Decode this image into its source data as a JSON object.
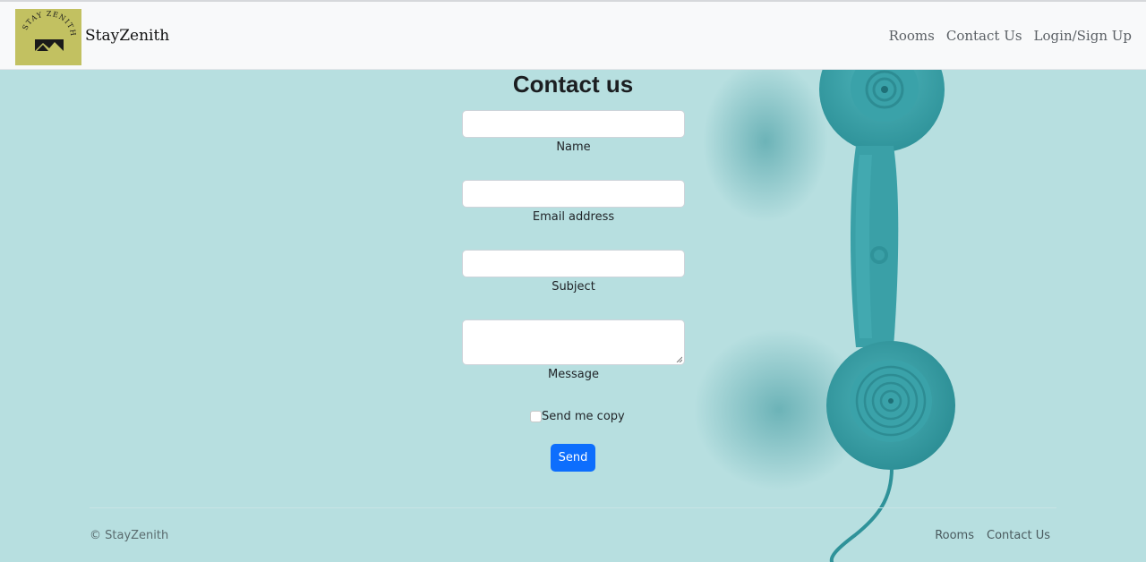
{
  "navbar": {
    "brand_name": "StayZenith",
    "logo_text": "STAY ZENITH",
    "links": [
      "Rooms",
      "Contact Us",
      "Login/Sign Up"
    ]
  },
  "form": {
    "title": "Contact us",
    "name_label": "Name",
    "email_label": "Email address",
    "subject_label": "Subject",
    "message_label": "Message",
    "name_value": "",
    "email_value": "",
    "subject_value": "",
    "message_value": "",
    "copy_checkbox_label": "Send me copy",
    "copy_checked": false,
    "send_label": "Send"
  },
  "footer": {
    "copyright": "© StayZenith",
    "links": [
      "Rooms",
      "Contact Us"
    ]
  },
  "colors": {
    "background": "#b7dfe0",
    "navbar": "#f8f9fa",
    "logo_bg": "#c2c161",
    "phone": "#3ea6ad",
    "button": "#0d6efd"
  },
  "icons": [
    "phone-handset-image",
    "logo-mountain-icon"
  ]
}
